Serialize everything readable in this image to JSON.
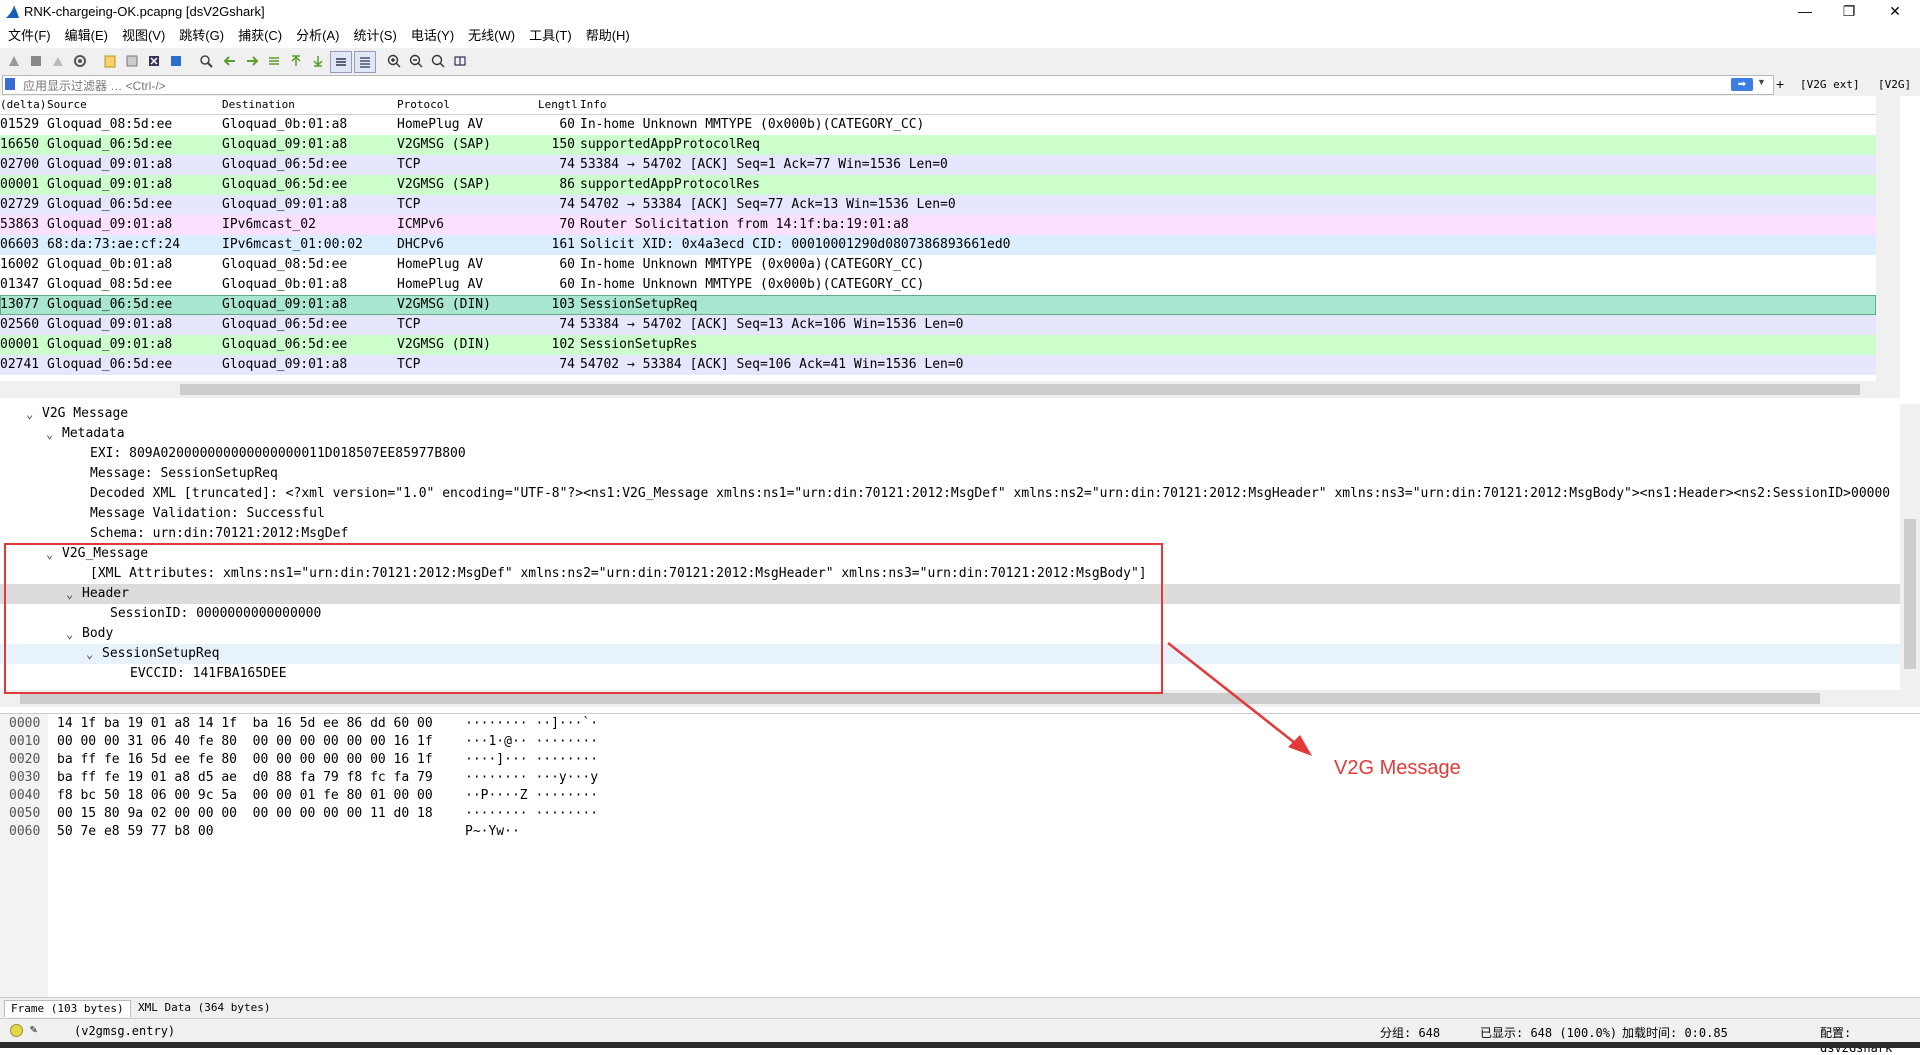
{
  "window": {
    "title": "RNK-chargeing-OK.pcapng [dsV2Gshark]"
  },
  "window_controls": {
    "minimize": "—",
    "maximize": "❐",
    "close": "✕"
  },
  "menu": [
    "文件(F)",
    "编辑(E)",
    "视图(V)",
    "跳转(G)",
    "捕获(C)",
    "分析(A)",
    "统计(S)",
    "电话(Y)",
    "无线(W)",
    "工具(T)",
    "帮助(H)"
  ],
  "filter": {
    "placeholder": "应用显示过滤器 … <Ctrl-/>",
    "buttons": [
      "[V2G ext]",
      "[V2G]"
    ]
  },
  "packet_list": {
    "columns": [
      "(delta)",
      "Source",
      "Destination",
      "Protocol",
      "Lengtl",
      "Info"
    ],
    "rows": [
      {
        "delta": "01529",
        "source": "Gloquad_08:5d:ee",
        "dest": "Gloquad_0b:01:a8",
        "proto": "HomePlug AV",
        "len": "60",
        "info": "In-home Unknown MMTYPE (0x000b)(CATEGORY_CC)",
        "bg": "#ffffff"
      },
      {
        "delta": "16650",
        "source": "Gloquad_06:5d:ee",
        "dest": "Gloquad_09:01:a8",
        "proto": "V2GMSG (SAP)",
        "len": "150",
        "info": "supportedAppProtocolReq",
        "bg": "#ccffcc"
      },
      {
        "delta": "02700",
        "source": "Gloquad_09:01:a8",
        "dest": "Gloquad_06:5d:ee",
        "proto": "TCP",
        "len": "74",
        "info": "53384 → 54702 [ACK] Seq=1 Ack=77 Win=1536 Len=0",
        "bg": "#e7e6ff"
      },
      {
        "delta": "00001",
        "source": "Gloquad_09:01:a8",
        "dest": "Gloquad_06:5d:ee",
        "proto": "V2GMSG (SAP)",
        "len": "86",
        "info": "supportedAppProtocolRes",
        "bg": "#ccffcc"
      },
      {
        "delta": "02729",
        "source": "Gloquad_06:5d:ee",
        "dest": "Gloquad_09:01:a8",
        "proto": "TCP",
        "len": "74",
        "info": "54702 → 53384 [ACK] Seq=77 Ack=13 Win=1536 Len=0",
        "bg": "#e7e6ff"
      },
      {
        "delta": "53863",
        "source": "Gloquad_09:01:a8",
        "dest": "IPv6mcast_02",
        "proto": "ICMPv6",
        "len": "70",
        "info": "Router Solicitation from 14:1f:ba:19:01:a8",
        "bg": "#fce0ff"
      },
      {
        "delta": "06603",
        "source": "68:da:73:ae:cf:24",
        "dest": "IPv6mcast_01:00:02",
        "proto": "DHCPv6",
        "len": "161",
        "info": "Solicit XID: 0x4a3ecd CID: 00010001290d0807386893661ed0",
        "bg": "#daeeff"
      },
      {
        "delta": "16002",
        "source": "Gloquad_0b:01:a8",
        "dest": "Gloquad_08:5d:ee",
        "proto": "HomePlug AV",
        "len": "60",
        "info": "In-home Unknown MMTYPE (0x000a)(CATEGORY_CC)",
        "bg": "#ffffff"
      },
      {
        "delta": "01347",
        "source": "Gloquad_08:5d:ee",
        "dest": "Gloquad_0b:01:a8",
        "proto": "HomePlug AV",
        "len": "60",
        "info": "In-home Unknown MMTYPE (0x000b)(CATEGORY_CC)",
        "bg": "#ffffff"
      },
      {
        "delta": "13077",
        "source": "Gloquad_06:5d:ee",
        "dest": "Gloquad_09:01:a8",
        "proto": "V2GMSG (DIN)",
        "len": "103",
        "info": "SessionSetupReq",
        "bg": "#a8e6cf"
      },
      {
        "delta": "02560",
        "source": "Gloquad_09:01:a8",
        "dest": "Gloquad_06:5d:ee",
        "proto": "TCP",
        "len": "74",
        "info": "53384 → 54702 [ACK] Seq=13 Ack=106 Win=1536 Len=0",
        "bg": "#e7e6ff"
      },
      {
        "delta": "00001",
        "source": "Gloquad_09:01:a8",
        "dest": "Gloquad_06:5d:ee",
        "proto": "V2GMSG (DIN)",
        "len": "102",
        "info": "SessionSetupRes",
        "bg": "#ccffcc"
      },
      {
        "delta": "02741",
        "source": "Gloquad_06:5d:ee",
        "dest": "Gloquad_09:01:a8",
        "proto": "TCP",
        "len": "74",
        "info": "54702 → 53384 [ACK] Seq=106 Ack=41 Win=1536 Len=0",
        "bg": "#e7e6ff"
      }
    ]
  },
  "detail_tree": [
    {
      "level": 0,
      "expand": "open",
      "text": "V2G Message",
      "hl": ""
    },
    {
      "level": 1,
      "expand": "open",
      "text": "Metadata",
      "hl": ""
    },
    {
      "level": 2,
      "expand": "",
      "text": "EXI: 809A020000000000000000011D018507EE85977B800",
      "hl": ""
    },
    {
      "level": 2,
      "expand": "",
      "text": "Message: SessionSetupReq",
      "hl": ""
    },
    {
      "level": 2,
      "expand": "",
      "text": "Decoded XML [truncated]: <?xml version=\"1.0\" encoding=\"UTF-8\"?><ns1:V2G_Message xmlns:ns1=\"urn:din:70121:2012:MsgDef\" xmlns:ns2=\"urn:din:70121:2012:MsgHeader\" xmlns:ns3=\"urn:din:70121:2012:MsgBody\"><ns1:Header><ns2:SessionID>00000",
      "hl": ""
    },
    {
      "level": 2,
      "expand": "",
      "text": "Message Validation: Successful",
      "hl": ""
    },
    {
      "level": 2,
      "expand": "",
      "text": "Schema: urn:din:70121:2012:MsgDef",
      "hl": ""
    },
    {
      "level": 1,
      "expand": "open",
      "text": "V2G_Message",
      "hl": ""
    },
    {
      "level": 2,
      "expand": "",
      "text": "[XML Attributes:  xmlns:ns1=\"urn:din:70121:2012:MsgDef\" xmlns:ns2=\"urn:din:70121:2012:MsgHeader\" xmlns:ns3=\"urn:din:70121:2012:MsgBody\"]",
      "hl": ""
    },
    {
      "level": 2,
      "expand": "open",
      "text": "Header",
      "hl": "#dcdcdc"
    },
    {
      "level": 3,
      "expand": "",
      "text": "SessionID: 0000000000000000",
      "hl": ""
    },
    {
      "level": 2,
      "expand": "open",
      "text": "Body",
      "hl": ""
    },
    {
      "level": 3,
      "expand": "open",
      "text": "SessionSetupReq",
      "hl": "#e8f2fb"
    },
    {
      "level": 4,
      "expand": "",
      "text": "EVCCID: 141FBA165DEE",
      "hl": ""
    }
  ],
  "bytes": [
    {
      "off": "0000",
      "hex": "14 1f ba 19 01 a8 14 1f  ba 16 5d ee 86 dd 60 00",
      "asc": "········ ··]···`·"
    },
    {
      "off": "0010",
      "hex": "00 00 00 31 06 40 fe 80  00 00 00 00 00 00 16 1f",
      "asc": "···1·@·· ········"
    },
    {
      "off": "0020",
      "hex": "ba ff fe 16 5d ee fe 80  00 00 00 00 00 00 16 1f",
      "asc": "····]··· ········"
    },
    {
      "off": "0030",
      "hex": "ba ff fe 19 01 a8 d5 ae  d0 88 fa 79 f8 fc fa 79",
      "asc": "········ ···y···y"
    },
    {
      "off": "0040",
      "hex": "f8 bc 50 18 06 00 9c 5a  00 00 01 fe 80 01 00 00",
      "asc": "··P····Z ········"
    },
    {
      "off": "0050",
      "hex": "00 15 80 9a 02 00 00 00  00 00 00 00 00 11 d0 18",
      "asc": "········ ········"
    },
    {
      "off": "0060",
      "hex": "50 7e e8 59 77 b8 00",
      "asc": "P~·Yw··"
    }
  ],
  "annotation": {
    "label": "V2G Message",
    "color": "#e23a3a"
  },
  "tabs": [
    "Frame (103 bytes)",
    "XML Data (364 bytes)"
  ],
  "status": {
    "field": "(v2gmsg.entry)",
    "packets": "分组: 648",
    "displayed": "已显示: 648 (100.0%)",
    "load_time": "加载时间: 0:0.85",
    "profile": "配置: dsV2Gshark"
  }
}
